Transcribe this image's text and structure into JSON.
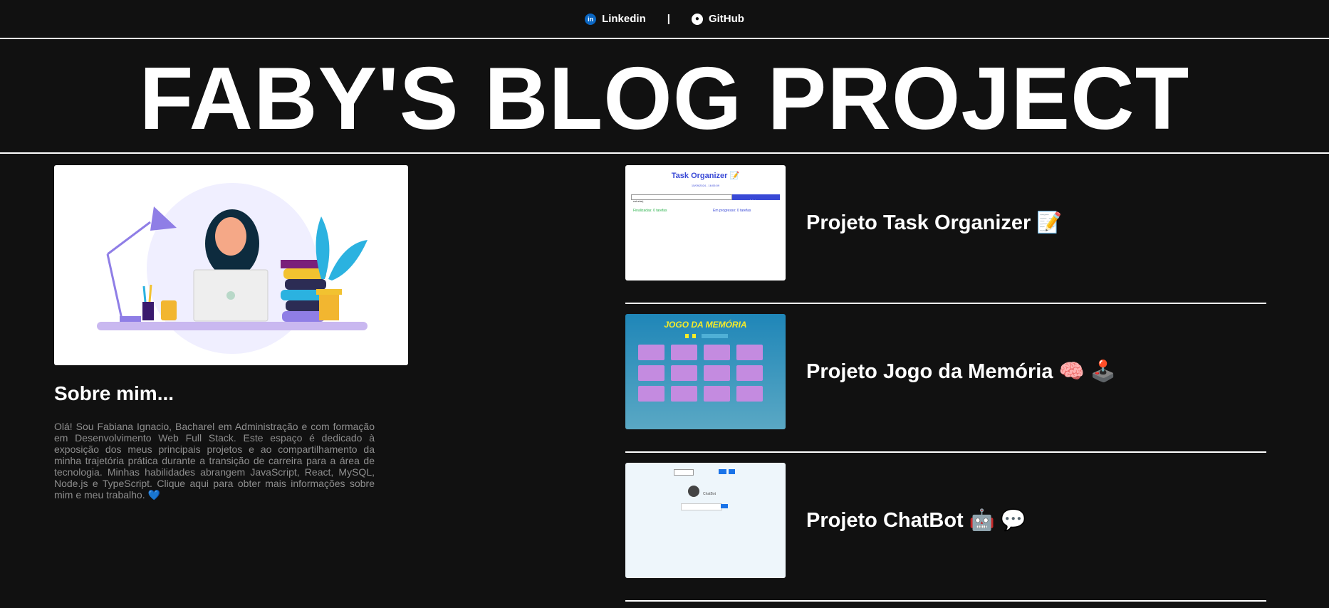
{
  "nav": {
    "linkedin_label": "Linkedin",
    "separator": "|",
    "github_label": "GitHub"
  },
  "hero": {
    "title": "FABY'S BLOG PROJECT"
  },
  "about": {
    "heading": "Sobre mim...",
    "text": "Olá! Sou Fabiana Ignacio, Bacharel em Administração e com formação em Desenvolvimento Web Full Stack. Este espaço é dedicado à exposição dos meus principais projetos e ao compartilhamento da minha trajetória prática durante a transição de carreira para a área de tecnologia. Minhas habilidades abrangem JavaScript, React, MySQL, Node.js e TypeScript. Clique aqui para obter mais informações sobre mim e meu trabalho. 💙"
  },
  "projects": [
    {
      "title": "Projeto Task Organizer 📝",
      "thumb": {
        "title": "Task Organizer 📝",
        "dates": "15/09/2024 - 16:05:09",
        "input_value": "estudar|",
        "button_label": "Adicionar",
        "done": "Finalizadas: 0 tarefas",
        "progress": "Em progresso: 0 tarefas"
      }
    },
    {
      "title": "Projeto Jogo da Memória 🧠 🕹️",
      "thumb": {
        "title": "JOGO DA MEMÓRIA"
      }
    },
    {
      "title": "Projeto ChatBot 🤖 💬",
      "thumb": {
        "label": "ChatBot"
      }
    }
  ]
}
